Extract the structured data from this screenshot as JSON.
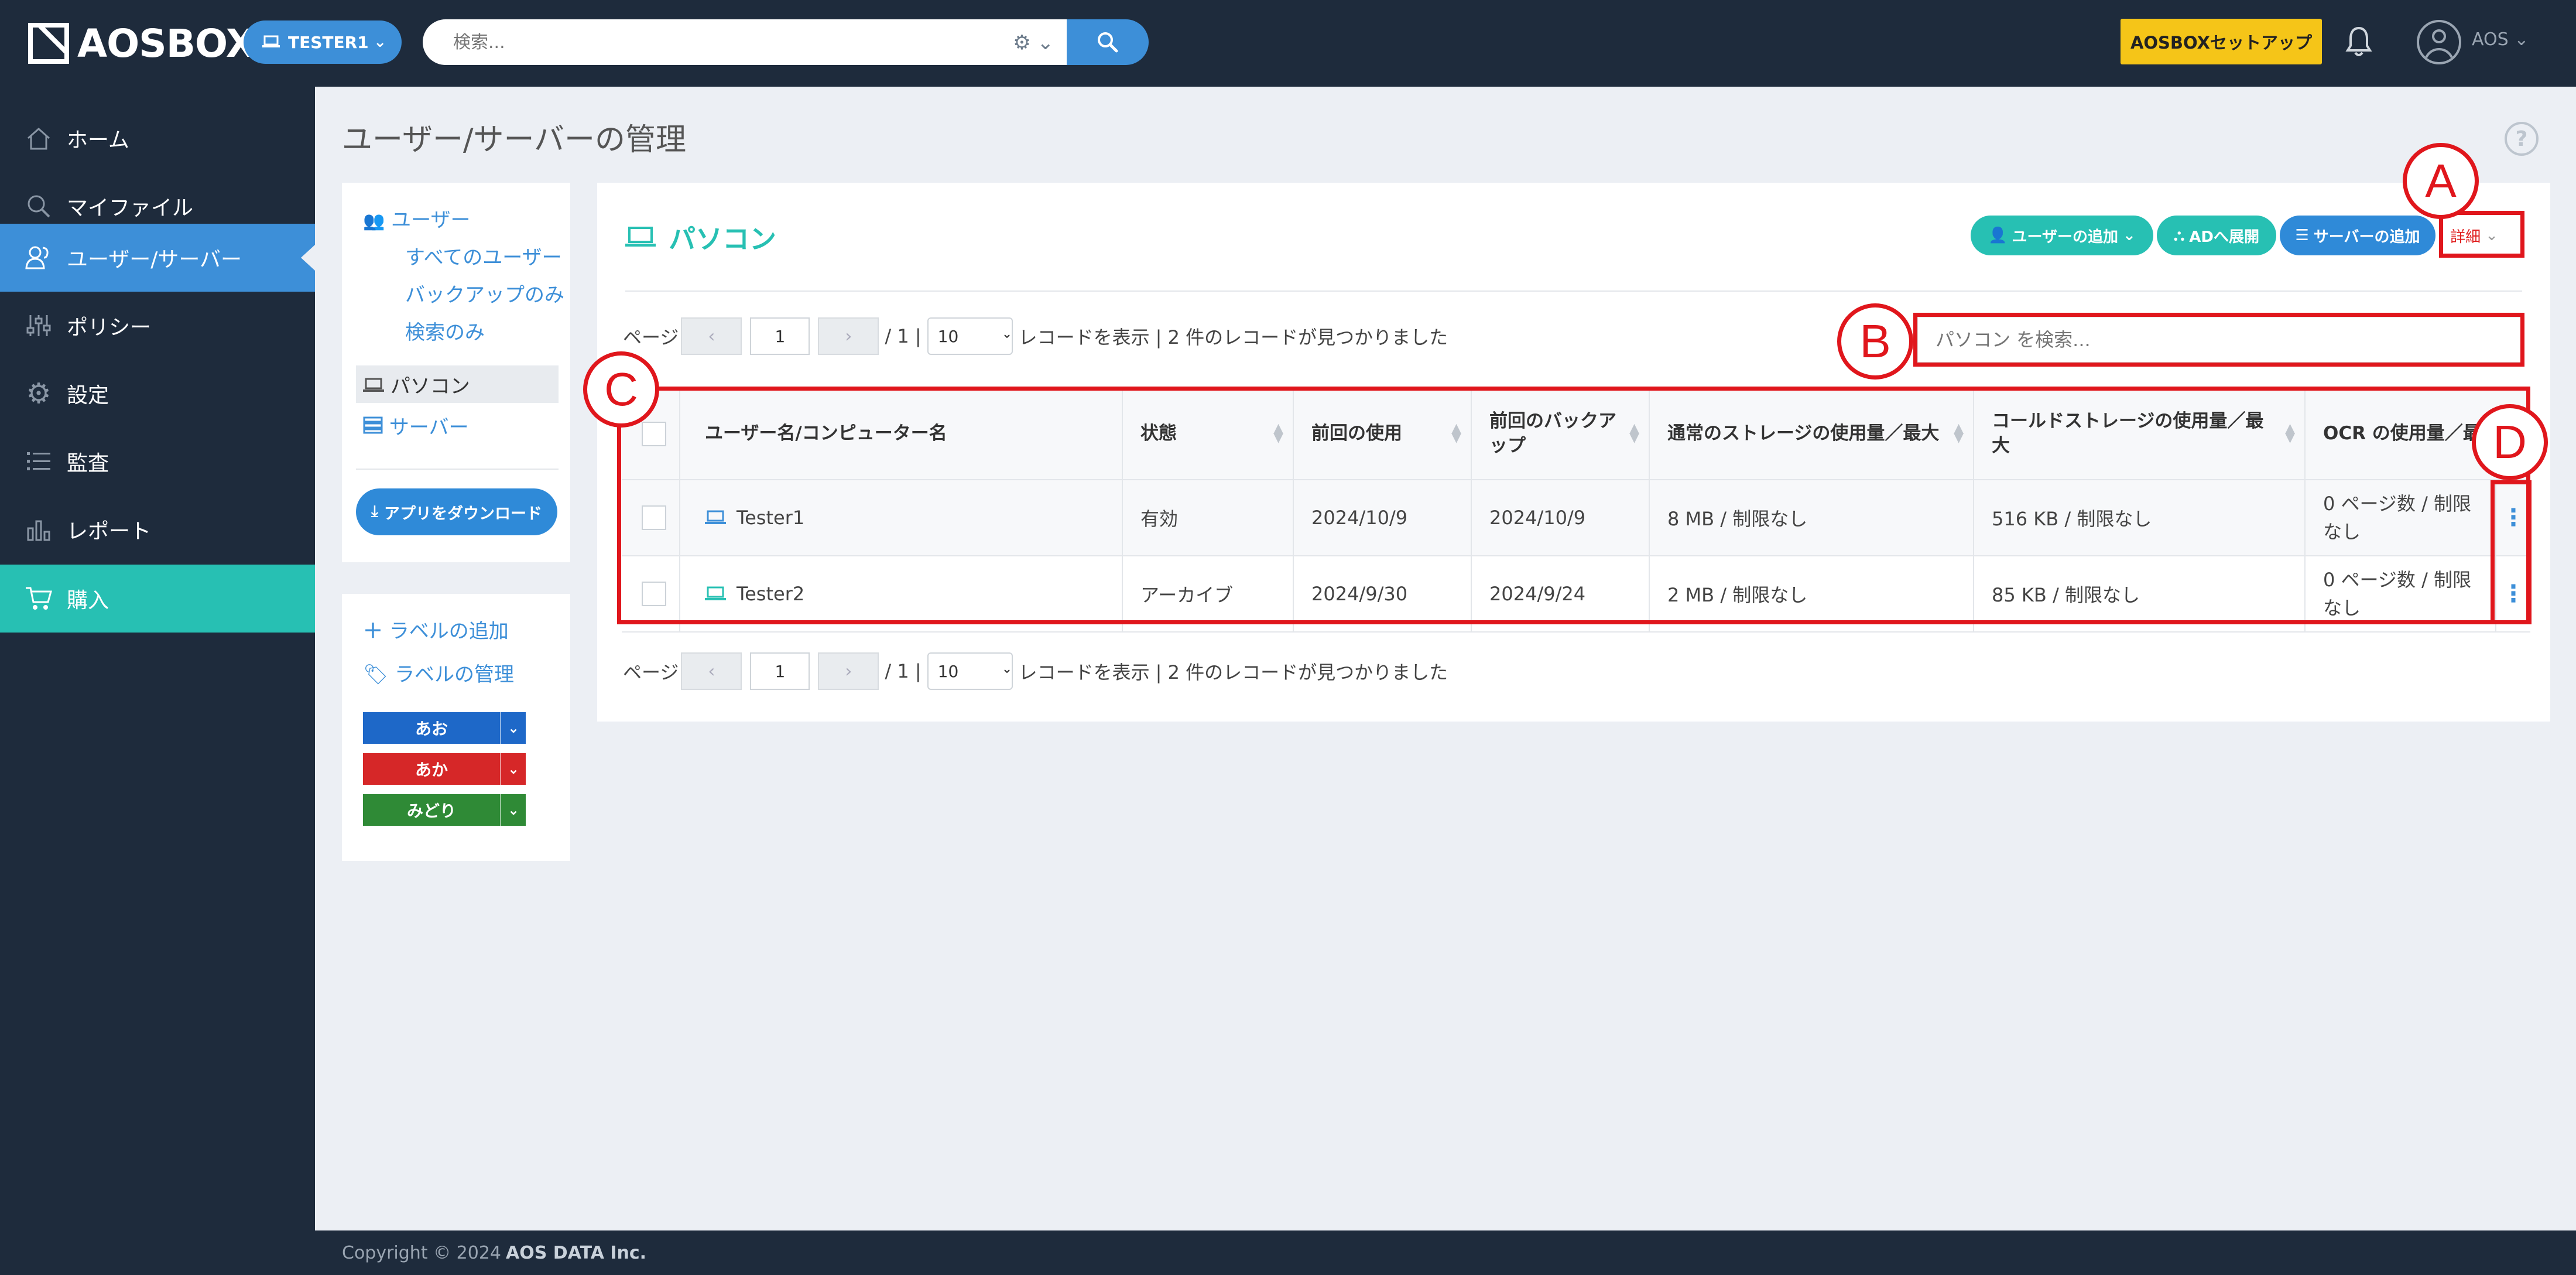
{
  "header": {
    "logo": "AOSBOX",
    "tester": "TESTER1",
    "search_placeholder": "検索...",
    "setup_label": "AOSBOXセットアップ",
    "user": "AOS"
  },
  "sidebar": {
    "items": [
      {
        "label": "ホーム",
        "icon": "home-icon"
      },
      {
        "label": "マイファイル",
        "icon": "search-icon"
      },
      {
        "label": "ユーザー/サーバー",
        "icon": "users-icon"
      },
      {
        "label": "ポリシー",
        "icon": "sliders-icon"
      },
      {
        "label": "設定",
        "icon": "gear-icon"
      },
      {
        "label": "監査",
        "icon": "list-icon"
      },
      {
        "label": "レポート",
        "icon": "bar-chart-icon"
      },
      {
        "label": "購入",
        "icon": "cart-icon"
      }
    ]
  },
  "page": {
    "title": "ユーザー/サーバーの管理",
    "help": "?"
  },
  "left_panel": {
    "users": "ユーザー",
    "all_users": "すべてのユーザー",
    "backup_only": "バックアップのみ",
    "search_only": "検索のみ",
    "pc": "パソコン",
    "server": "サーバー",
    "download": "アプリをダウンロード"
  },
  "label_panel": {
    "add_label": "ラベルの追加",
    "manage_label": "ラベルの管理",
    "labels": [
      {
        "name": "あお",
        "color": "#1e68c8"
      },
      {
        "name": "あか",
        "color": "#d62728"
      },
      {
        "name": "みどり",
        "color": "#2f8a36"
      }
    ]
  },
  "main": {
    "title": "パソコン",
    "add_user": "ユーザーの追加",
    "ad_deploy": "ADへ展開",
    "add_server": "サーバーの追加",
    "detail": "詳細",
    "pager": {
      "page_label": "ページ",
      "prev": "‹",
      "next": "›",
      "current": "1",
      "total": "/ 1 |",
      "per_page": "10",
      "per_page_label": "レコードを表示",
      "found": "| 2 件のレコードが見つかりました"
    },
    "search_placeholder": "パソコン を検索...",
    "table": {
      "headers": [
        "ユーザー名/コンピューター名",
        "状態",
        "前回の使用",
        "前回のバックアップ",
        "通常のストレージの使用量／最大",
        "コールドストレージの使用量／最大",
        "OCR の使用量／最大"
      ],
      "rows": [
        {
          "name": "Tester1",
          "status": "有効",
          "last_used": "2024/10/9",
          "last_backup": "2024/10/9",
          "storage": "8 MB / 制限なし",
          "cold": "516 KB / 制限なし",
          "ocr": "0 ページ数 / 制限なし"
        },
        {
          "name": "Tester2",
          "status": "アーカイブ",
          "last_used": "2024/9/30",
          "last_backup": "2024/9/24",
          "storage": "2 MB / 制限なし",
          "cold": "85 KB / 制限なし",
          "ocr": "0 ページ数 / 制限なし"
        }
      ]
    }
  },
  "annotations": [
    "A",
    "B",
    "C",
    "D"
  ],
  "footer": {
    "copyright": "Copyright © 2024",
    "company": "AOS DATA Inc."
  }
}
